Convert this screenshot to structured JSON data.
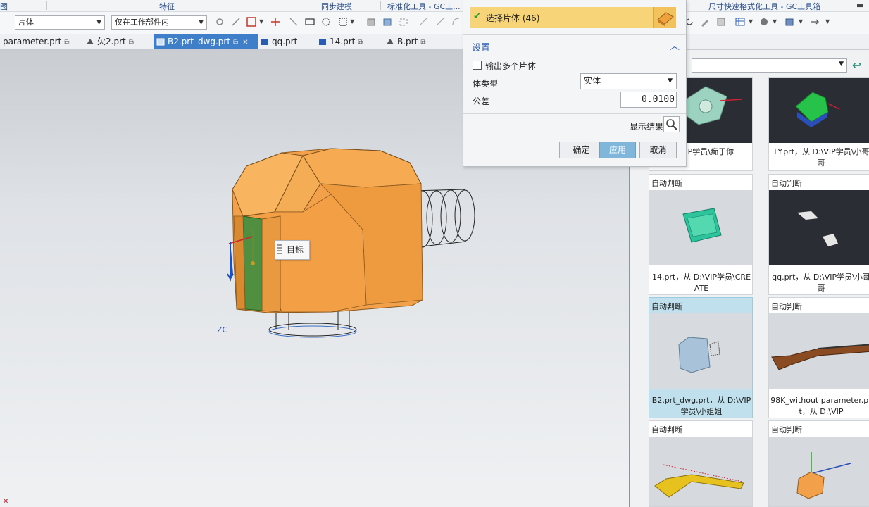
{
  "ribbon": {
    "groups": [
      "图",
      "特征",
      "同步建模",
      "标准化工具 - GC工...",
      "尺寸快速格式化工具 - GC工具箱"
    ]
  },
  "toolbar": {
    "filter_type": "片体",
    "filter_scope": "仅在工作部件内"
  },
  "tabs": [
    {
      "label": "parameter.prt",
      "active": false
    },
    {
      "label": "欠2.prt",
      "active": false
    },
    {
      "label": "B2.prt_dwg.prt",
      "active": true
    },
    {
      "label": "qq.prt",
      "active": false
    },
    {
      "label": "14.prt",
      "active": false
    },
    {
      "label": "B.prt",
      "active": false
    }
  ],
  "viewport": {
    "tooltip": "目标",
    "axis_label": "ZC"
  },
  "dialog": {
    "selection_label": "选择片体 (46)",
    "settings_label": "设置",
    "multi_body_label": "输出多个片体",
    "multi_body_checked": false,
    "body_type_label": "体类型",
    "body_type_value": "实体",
    "tolerance_label": "公差",
    "tolerance_value": "0.0100",
    "show_result_label": "显示结果",
    "ok_label": "确定",
    "apply_label": "应用",
    "cancel_label": "取消"
  },
  "panel": {
    "cards": [
      {
        "header": "",
        "caption": "D:\\VIP学员\\痴于你",
        "thumb": "dark"
      },
      {
        "header": "",
        "caption": "TY.prt，从 D:\\VIP学员\\小哥哥",
        "thumb": "dark"
      },
      {
        "header": "自动判断",
        "caption": "14.prt，从 D:\\VIP学员\\CREATE",
        "thumb": "light"
      },
      {
        "header": "自动判断",
        "caption": "qq.prt，从 D:\\VIP学员\\小哥哥",
        "thumb": "dark"
      },
      {
        "header": "自动判断",
        "caption": "B2.prt_dwg.prt，从 D:\\VIP学员\\小姐姐",
        "thumb": "light",
        "selected": true
      },
      {
        "header": "自动判断",
        "caption": "98K_without parameter.prt，从 D:\\VIP",
        "thumb": "light"
      },
      {
        "header": "自动判断",
        "caption": "",
        "thumb": "light"
      },
      {
        "header": "自动判断",
        "caption": "",
        "thumb": "light"
      }
    ]
  },
  "colors": {
    "accent": "#3f7ec9",
    "selection_highlight": "#f7d478",
    "apply_button": "#7fb6d9",
    "model_orange": "#f2a04a",
    "model_green": "#4f8f3f"
  }
}
